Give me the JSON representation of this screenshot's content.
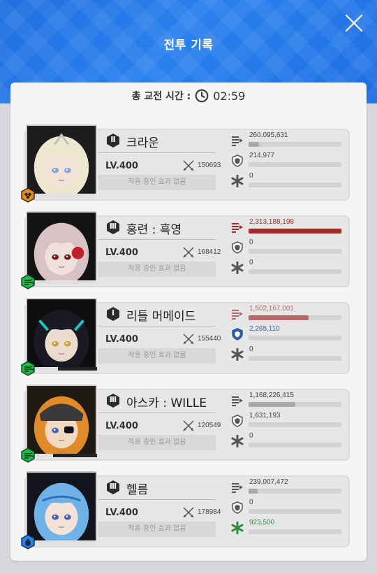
{
  "header": {
    "title": "전투 기록"
  },
  "summary": {
    "label": "총 교전 시간 :",
    "time": "02:59"
  },
  "colors": {
    "header_blue": "#2a80ee",
    "damage_top": "#a52a2a",
    "damage_mid": "#b76a6a",
    "damage_low": "#a9a9a9",
    "shield": "#2f5f9e",
    "heal": "#2e8b3e"
  },
  "characters": [
    {
      "name": "크라운",
      "burst": "Ⅱ",
      "level": "LV.400",
      "power": "150693",
      "effect": "적용 중인 효과 없음",
      "class_icon": "defender-class-icon",
      "hp": 1.0,
      "damage": "260,095,631",
      "damage_fill": 0.11,
      "shield": "214,977",
      "shield_fill": 0,
      "heal": "0",
      "heal_fill": 0
    },
    {
      "name": "홍련 : 흑영",
      "burst": "Ⅲ",
      "level": "LV.400",
      "power": "168412",
      "effect": "적용 중인 효과 없음",
      "class_icon": "wind-class-icon",
      "hp": 1.0,
      "damage": "2,313,188,198",
      "damage_fill": 1.0,
      "shield": "0",
      "shield_fill": 0,
      "heal": "0",
      "heal_fill": 0
    },
    {
      "name": "리틀 머메이드",
      "burst": "Ⅰ",
      "level": "LV.400",
      "power": "155440",
      "effect": "적용 중인 효과 없음",
      "class_icon": "wind-class-icon",
      "hp": 0.45,
      "damage": "1,502,167,001",
      "damage_fill": 0.65,
      "shield": "2,265,110",
      "shield_fill": 0,
      "heal": "0",
      "heal_fill": 0
    },
    {
      "name": "아스카 : WILLE",
      "burst": "Ⅲ",
      "level": "LV.400",
      "power": "120549",
      "effect": "적용 중인 효과 없음",
      "class_icon": "wind-class-icon",
      "hp": 0.38,
      "damage": "1,168,226,415",
      "damage_fill": 0.5,
      "shield": "1,631,193",
      "shield_fill": 0,
      "heal": "0",
      "heal_fill": 0
    },
    {
      "name": "헬름",
      "burst": "Ⅲ",
      "level": "LV.400",
      "power": "178984",
      "effect": "적용 중인 효과 없음",
      "class_icon": "water-class-icon",
      "hp": 1.0,
      "damage": "239,007,472",
      "damage_fill": 0.1,
      "shield": "0",
      "shield_fill": 0,
      "heal": "923,500",
      "heal_fill": 0
    }
  ]
}
